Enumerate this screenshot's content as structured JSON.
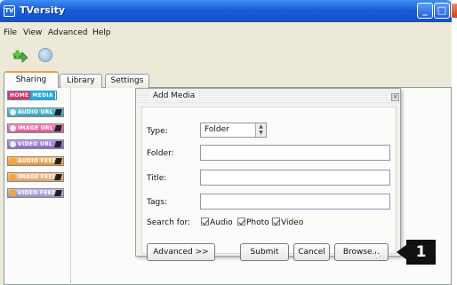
{
  "window": {
    "title": "TVersity"
  },
  "menu": [
    "File",
    "View",
    "Advanced",
    "Help"
  ],
  "tabs": [
    "Sharing",
    "Library",
    "Settings"
  ],
  "sidebar": {
    "home": [
      "HOME",
      "MEDIA"
    ],
    "items": [
      "AUDIO URL",
      "IMAGE URL",
      "VIDEO URL",
      "AUDIO FEED",
      "IMAGE FEED",
      "VIDEO FEED"
    ]
  },
  "dialog": {
    "title": "Add Media",
    "type_label": "Type:",
    "type_value": "Folder",
    "folder_label": "Folder:",
    "title_label": "Title:",
    "tags_label": "Tags:",
    "search_for_label": "Search for:",
    "checkboxes": [
      "Audio",
      "Photo",
      "Video"
    ],
    "advanced_button": "Advanced >>",
    "submit_button": "Submit",
    "cancel_button": "Cancel",
    "browse_button": "Browse..."
  },
  "callout": {
    "number": "1"
  }
}
